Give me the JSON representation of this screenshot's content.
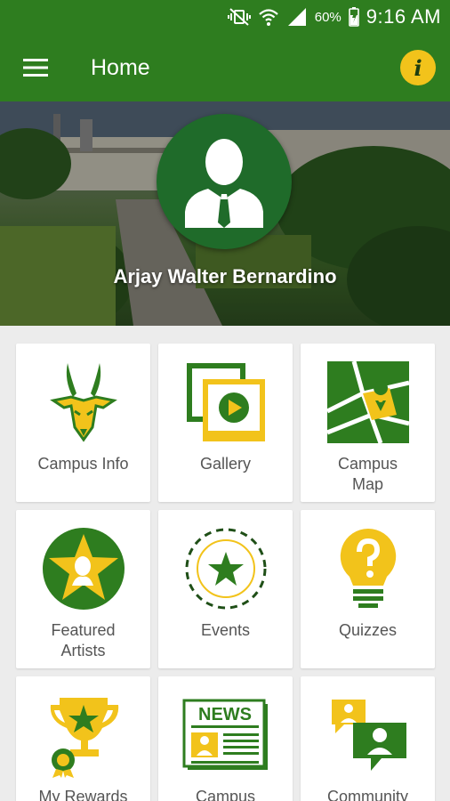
{
  "status_bar": {
    "battery": "60%",
    "time": "9:16 AM"
  },
  "app_bar": {
    "title": "Home",
    "info_label": "i"
  },
  "profile": {
    "name": "Arjay Walter Bernardino"
  },
  "colors": {
    "primary_green": "#2e7d1f",
    "accent_yellow": "#f2c31b",
    "dark_green": "#1f6b2a",
    "tile_bg": "#ffffff",
    "page_bg": "#ececec"
  },
  "menu": [
    {
      "label": "Campus Info",
      "icon": "antelope-icon"
    },
    {
      "label": "Gallery",
      "icon": "gallery-icon"
    },
    {
      "label": "Campus Map",
      "icon": "map-icon"
    },
    {
      "label": "Featured Artists",
      "icon": "featured-artists-icon"
    },
    {
      "label": "Events",
      "icon": "events-icon"
    },
    {
      "label": "Quizzes",
      "icon": "lightbulb-icon"
    },
    {
      "label": "My Rewards",
      "icon": "trophy-icon"
    },
    {
      "label": "Campus",
      "icon": "news-icon"
    },
    {
      "label": "Community",
      "icon": "chat-icon"
    }
  ],
  "news_icon_text": "NEWS"
}
